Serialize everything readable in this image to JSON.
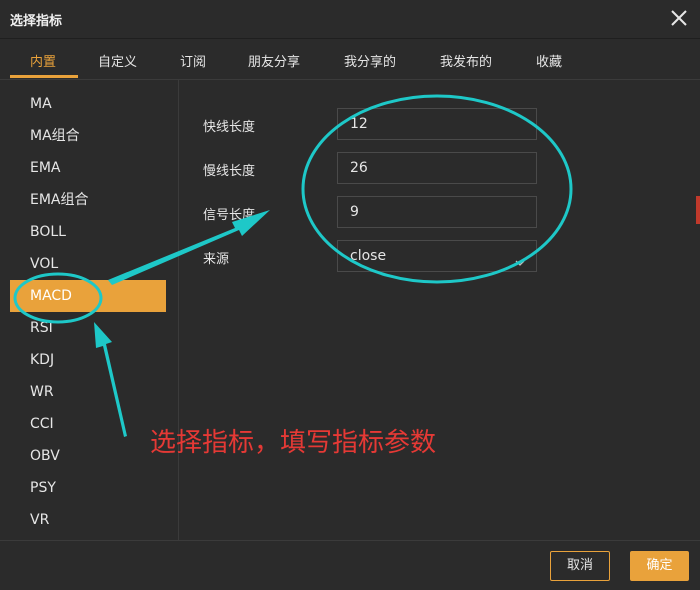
{
  "window": {
    "title": "选择指标"
  },
  "tabs": [
    {
      "label": "内置",
      "active": true
    },
    {
      "label": "自定义"
    },
    {
      "label": "订阅"
    },
    {
      "label": "朋友分享"
    },
    {
      "label": "我分享的"
    },
    {
      "label": "我发布的"
    },
    {
      "label": "收藏"
    }
  ],
  "sidebar": {
    "items": [
      "MA",
      "MA组合",
      "EMA",
      "EMA组合",
      "BOLL",
      "VOL",
      "MACD",
      "RSI",
      "KDJ",
      "WR",
      "CCI",
      "OBV",
      "PSY",
      "VR"
    ],
    "selected": "MACD"
  },
  "params": {
    "fast": {
      "label": "快线长度",
      "value": "12"
    },
    "slow": {
      "label": "慢线长度",
      "value": "26"
    },
    "signal": {
      "label": "信号长度",
      "value": "9"
    },
    "source": {
      "label": "来源",
      "value": "close"
    }
  },
  "footer": {
    "cancel_label": "取消",
    "ok_label": "确定"
  },
  "annotation": {
    "text": "选择指标，填写指标参数",
    "color": "#e53935",
    "marker_color": "#1ec8c8"
  },
  "colors": {
    "accent": "#e9a23b",
    "background": "#2b2b2b"
  },
  "icons": {
    "close": "close-icon",
    "dropdown": "chevron-down-icon"
  }
}
